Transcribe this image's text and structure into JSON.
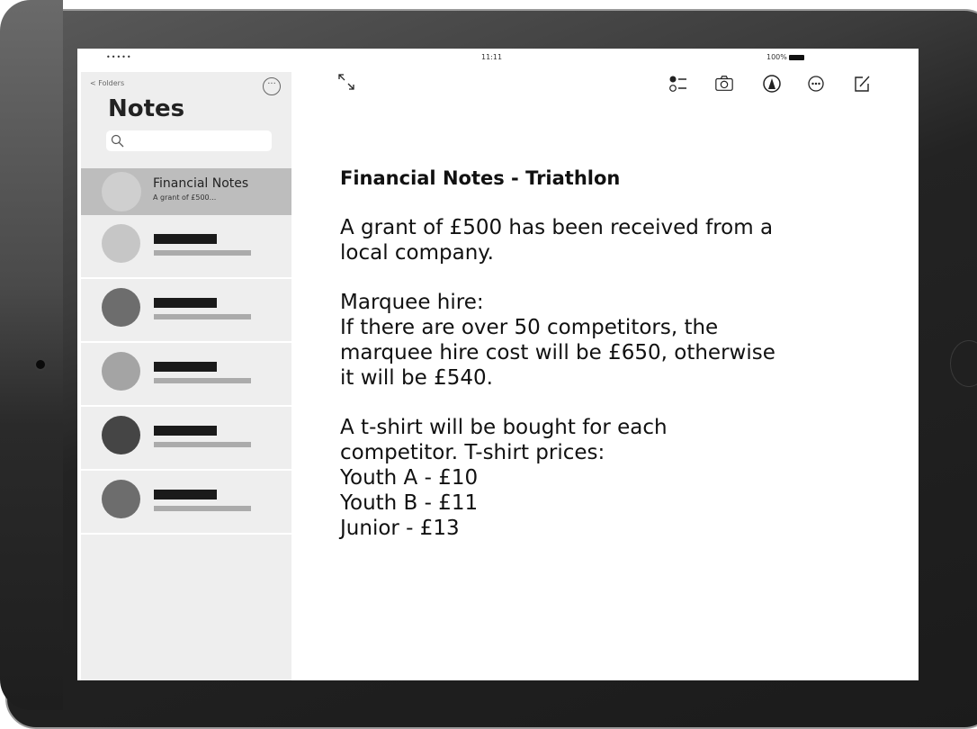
{
  "status_bar": {
    "signal": "•••••",
    "time": "11:11",
    "battery": "100%"
  },
  "sidebar": {
    "back_label": "Folders",
    "title": "Notes",
    "search_placeholder": "",
    "notes": [
      {
        "title": "Financial Notes",
        "snippet": "A grant of £500...",
        "selected": true,
        "avatar_color": "#cfcfcf"
      },
      {
        "title": "",
        "snippet": "",
        "selected": false,
        "avatar_color": "#c6c6c6"
      },
      {
        "title": "",
        "snippet": "",
        "selected": false,
        "avatar_color": "#6d6d6d"
      },
      {
        "title": "",
        "snippet": "",
        "selected": false,
        "avatar_color": "#a4a4a4"
      },
      {
        "title": "",
        "snippet": "",
        "selected": false,
        "avatar_color": "#454545"
      },
      {
        "title": "",
        "snippet": "",
        "selected": false,
        "avatar_color": "#6d6d6d"
      }
    ]
  },
  "toolbar": {
    "icons": [
      "expand-icon",
      "checklist-icon",
      "camera-icon",
      "markup-icon",
      "more-icon",
      "compose-icon"
    ]
  },
  "note": {
    "heading": "Financial Notes - Triathlon",
    "paragraphs": [
      "A grant of £500 has been received from a\nlocal company.",
      "Marquee hire:\nIf there are over 50 competitors, the\nmarquee hire cost will be £650, otherwise\nit will be £540.",
      "A t-shirt will be bought for each\ncompetitor.  T-shirt prices:\nYouth A - £10\nYouth B - £11\nJunior - £13"
    ]
  }
}
